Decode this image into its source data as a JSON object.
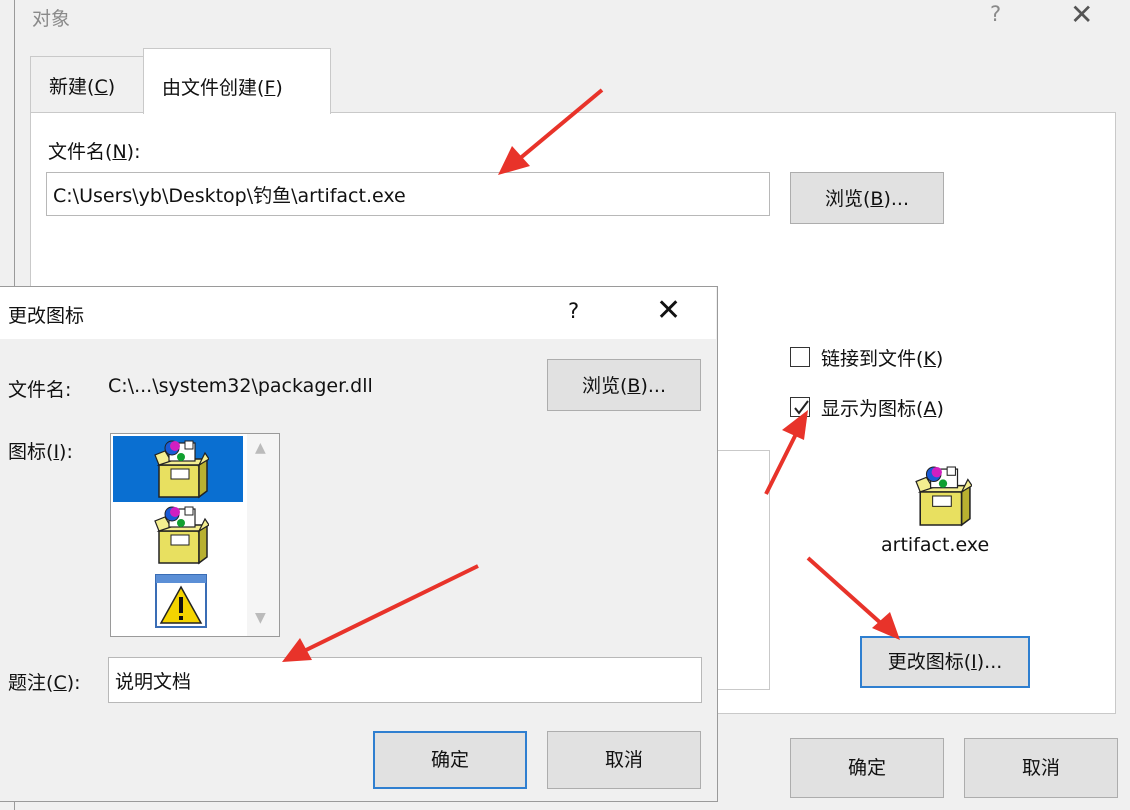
{
  "main_dialog": {
    "title": "对象",
    "help": "?",
    "close": "✕",
    "tabs": [
      {
        "label": "新建",
        "key": "C"
      },
      {
        "label": "由文件创建",
        "key": "F"
      }
    ],
    "filename_label": "文件名",
    "filename_key": "N",
    "filename_value": "C:\\Users\\yb\\Desktop\\钓鱼\\artifact.exe",
    "browse_label": "浏览",
    "browse_key": "B",
    "link_label": "链接到文件",
    "link_key": "K",
    "link_checked": false,
    "display_as_icon_label": "显示为图标",
    "display_as_icon_key": "A",
    "display_as_icon_checked": true,
    "icon_caption": "artifact.exe",
    "change_icon_label": "更改图标",
    "change_icon_key": "I",
    "ok_label": "确定",
    "cancel_label": "取消"
  },
  "icon_dialog": {
    "title": "更改图标",
    "help": "?",
    "close": "✕",
    "filename_label": "文件名:",
    "filename_value": "C:\\...\\system32\\packager.dll",
    "browse_label": "浏览",
    "browse_key": "B",
    "icon_label": "图标",
    "icon_key": "I",
    "icons": [
      "package-icon",
      "package-icon",
      "warning-icon"
    ],
    "selected_icon_index": 0,
    "caption_label": "题注",
    "caption_key": "C",
    "caption_value": "说明文档",
    "ok_label": "确定",
    "cancel_label": "取消"
  },
  "colors": {
    "annotation_red": "#e8332a",
    "selection_blue": "#0a6fd1",
    "focus_border": "#2f7fd0"
  }
}
